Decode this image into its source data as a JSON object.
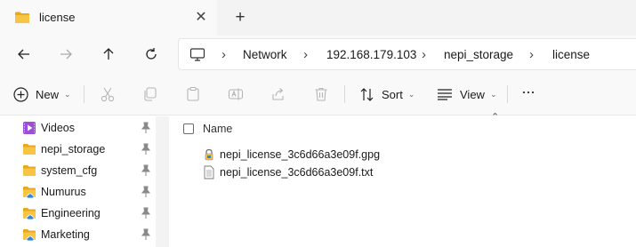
{
  "tab": {
    "title": "license",
    "close_symbol": "✕",
    "new_tab_symbol": "+"
  },
  "breadcrumb": [
    "Network",
    "192.168.179.103",
    "nepi_storage",
    "license"
  ],
  "toolbar": {
    "new_label": "New",
    "sort_label": "Sort",
    "view_label": "View",
    "more_symbol": "···"
  },
  "sidebar": {
    "items": [
      {
        "label": "Videos",
        "icon": "videos-icon",
        "pinned": true
      },
      {
        "label": "nepi_storage",
        "icon": "folder-icon",
        "pinned": true
      },
      {
        "label": "system_cfg",
        "icon": "folder-icon",
        "pinned": true
      },
      {
        "label": "Numurus",
        "icon": "onedrive-icon",
        "pinned": true
      },
      {
        "label": "Engineering",
        "icon": "onedrive-icon",
        "pinned": true
      },
      {
        "label": "Marketing",
        "icon": "onedrive-icon",
        "pinned": true
      }
    ]
  },
  "content": {
    "column_name": "Name",
    "files": [
      {
        "name": "nepi_license_3c6d66a3e09f.gpg",
        "icon": "gpg-file-icon"
      },
      {
        "name": "nepi_license_3c6d66a3e09f.txt",
        "icon": "text-file-icon"
      }
    ]
  },
  "colors": {
    "folder": "#f7c443",
    "accent": "#0067c0",
    "videos": "#9b4fd8",
    "onedrive": "#2b88d8"
  }
}
